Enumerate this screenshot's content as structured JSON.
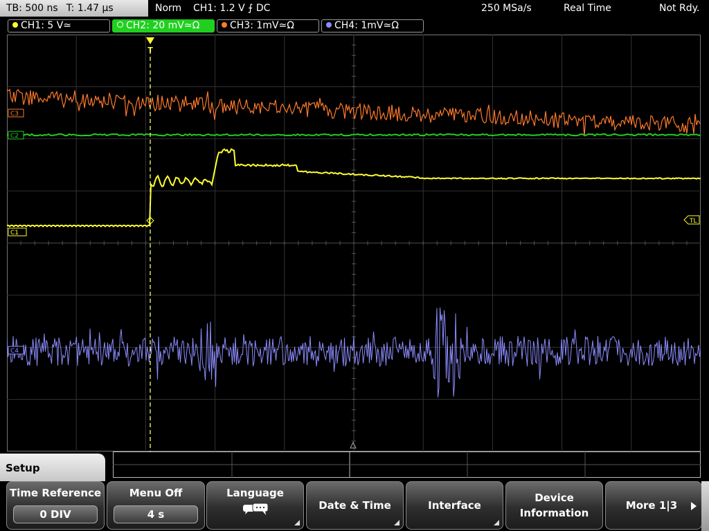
{
  "status": {
    "timebase": "TB: 500 ns",
    "time": "T: 1.47 µs",
    "mode": "Norm",
    "trigger": "CH1: 1.2 V ⨍ DC",
    "samplerate": "250 MSa/s",
    "acq": "Real Time",
    "state": "Not Rdy."
  },
  "channels": [
    {
      "label": "CH1: 5 V≃",
      "color": "#ffff33"
    },
    {
      "label": "CH2: 20 mV≃Ω",
      "color": "#20d020"
    },
    {
      "label": "CH3: 1mV≃Ω",
      "color": "#ff7a2a"
    },
    {
      "label": "CH4: 1mV≃Ω",
      "color": "#8c8cff"
    }
  ],
  "markers": {
    "c1": "C1",
    "c2": "C2",
    "c3": "C3",
    "c4": "C4",
    "tl": "TL",
    "trigger": "T"
  },
  "menu": {
    "title": "Setup",
    "buttons": [
      {
        "label": "Time Reference",
        "value": "0 DIV"
      },
      {
        "label": "Menu Off",
        "value": "4 s"
      },
      {
        "label": "Language",
        "value": ""
      },
      {
        "label": "Date & Time",
        "value": ""
      },
      {
        "label": "Interface",
        "value": ""
      },
      {
        "label": "Device",
        "label2": "Information",
        "value": ""
      },
      {
        "label": "More 1|3",
        "value": ""
      }
    ]
  },
  "colors": {
    "grid": "#3a3a3a",
    "ch1": "#ffff33",
    "ch2": "#20d020",
    "ch3": "#ff7a2a",
    "ch4": "#8c8cff"
  }
}
